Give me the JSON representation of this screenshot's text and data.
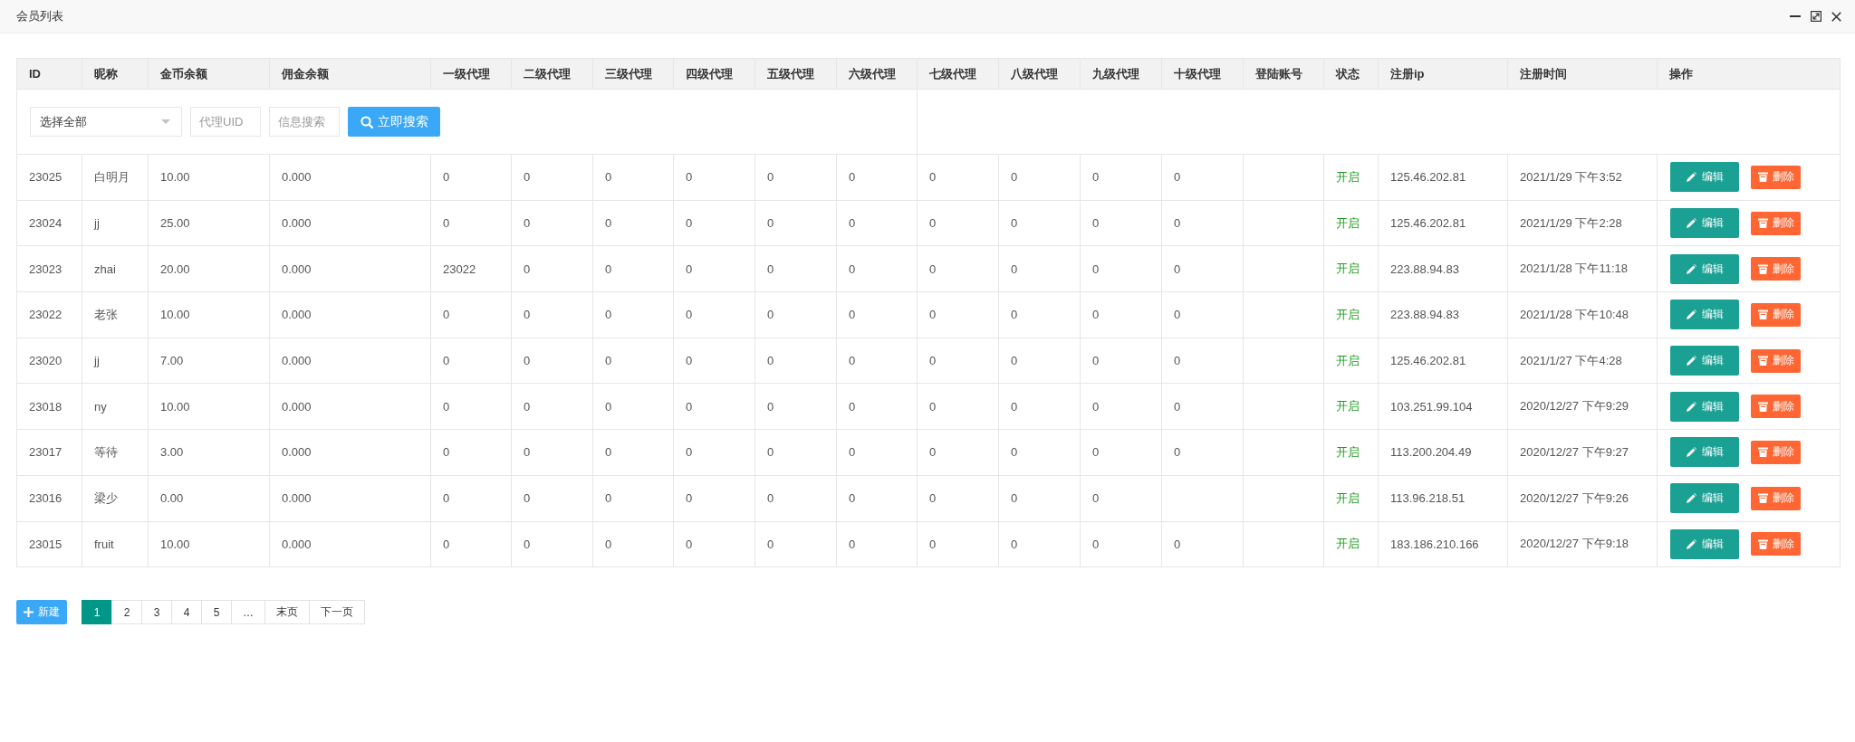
{
  "window": {
    "title": "会员列表"
  },
  "table": {
    "columns": [
      "ID",
      "昵称",
      "金币余额",
      "佣金余额",
      "一级代理",
      "二级代理",
      "三级代理",
      "四级代理",
      "五级代理",
      "六级代理",
      "七级代理",
      "八级代理",
      "九级代理",
      "十级代理",
      "登陆账号",
      "状态",
      "注册ip",
      "注册时间",
      "操作"
    ],
    "filter": {
      "select": {
        "value": "选择全部"
      },
      "agent_uid": {
        "placeholder": "代理UID"
      },
      "info_search": {
        "placeholder": "信息搜索"
      },
      "search_button": "立即搜索"
    },
    "rows": [
      {
        "id": "23025",
        "nickname": "白明月",
        "coins": "10.00",
        "commission": "0.000",
        "agents": [
          "0",
          "0",
          "0",
          "0",
          "0",
          "0",
          "0",
          "0",
          "0",
          "0"
        ],
        "status": "开启",
        "ip": "125.46.202.81",
        "registered": "2021/1/29 下午3:52",
        "actions": [
          {
            "kind": "edit",
            "label": "编辑"
          },
          {
            "kind": "delete",
            "label": "删除"
          }
        ]
      },
      {
        "id": "23024",
        "nickname": "jj",
        "coins": "25.00",
        "commission": "0.000",
        "agents": [
          "0",
          "0",
          "0",
          "0",
          "0",
          "0",
          "0",
          "0",
          "0",
          "0"
        ],
        "status": "开启",
        "ip": "125.46.202.81",
        "registered": "2021/1/29 下午2:28",
        "actions": [
          {
            "kind": "edit",
            "label": "编辑"
          },
          {
            "kind": "delete",
            "label": "删除"
          }
        ]
      },
      {
        "id": "23023",
        "nickname": "zhai",
        "coins": "20.00",
        "commission": "0.000",
        "agents": [
          "23022",
          "0",
          "0",
          "0",
          "0",
          "0",
          "0",
          "0",
          "0",
          "0"
        ],
        "status": "开启",
        "ip": "223.88.94.83",
        "registered": "2021/1/28 下午11:18",
        "actions": [
          {
            "kind": "edit",
            "label": "编辑"
          },
          {
            "kind": "delete",
            "label": "删除"
          }
        ]
      },
      {
        "id": "23022",
        "nickname": "老张",
        "coins": "10.00",
        "commission": "0.000",
        "agents": [
          "0",
          "0",
          "0",
          "0",
          "0",
          "0",
          "0",
          "0",
          "0",
          "0"
        ],
        "status": "开启",
        "ip": "223.88.94.83",
        "registered": "2021/1/28 下午10:48",
        "actions": [
          {
            "kind": "edit",
            "label": "编辑"
          },
          {
            "kind": "delete",
            "label": "删除"
          }
        ]
      },
      {
        "id": "23020",
        "nickname": "jj",
        "coins": "7.00",
        "commission": "0.000",
        "agents": [
          "0",
          "0",
          "0",
          "0",
          "0",
          "0",
          "0",
          "0",
          "0",
          "0"
        ],
        "status": "开启",
        "ip": "125.46.202.81",
        "registered": "2021/1/27 下午4:28",
        "actions": [
          {
            "kind": "edit",
            "label": "编辑"
          },
          {
            "kind": "delete",
            "label": "删除"
          }
        ]
      },
      {
        "id": "23018",
        "nickname": "ny",
        "coins": "10.00",
        "commission": "0.000",
        "agents": [
          "0",
          "0",
          "0",
          "0",
          "0",
          "0",
          "0",
          "0",
          "0",
          "0"
        ],
        "status": "开启",
        "ip": "103.251.99.104",
        "registered": "2020/12/27 下午9:29",
        "actions": [
          {
            "kind": "edit",
            "label": "编辑"
          },
          {
            "kind": "delete",
            "label": "删除"
          }
        ]
      },
      {
        "id": "23017",
        "nickname": "等待",
        "coins": "3.00",
        "commission": "0.000",
        "agents": [
          "0",
          "0",
          "0",
          "0",
          "0",
          "0",
          "0",
          "0",
          "0",
          "0"
        ],
        "status": "开启",
        "ip": "113.200.204.49",
        "registered": "2020/12/27 下午9:27",
        "actions": [
          {
            "kind": "edit",
            "label": "编辑"
          },
          {
            "kind": "delete",
            "label": "删除"
          }
        ]
      },
      {
        "id": "23016",
        "nickname": "梁少",
        "coins": "0.00",
        "commission": "0.000",
        "agents": [
          "0",
          "0",
          "0",
          "0",
          "0",
          "0",
          "0",
          "0",
          "0"
        ],
        "status": "开启",
        "ip": "113.96.218.51",
        "registered": "2020/12/27 下午9:26",
        "actions": [
          {
            "kind": "edit",
            "label": "编辑"
          },
          {
            "kind": "delete",
            "label": "删除"
          }
        ]
      },
      {
        "id": "23015",
        "nickname": "fruit",
        "coins": "10.00",
        "commission": "0.000",
        "agents": [
          "0",
          "0",
          "0",
          "0",
          "0",
          "0",
          "0",
          "0",
          "0",
          "0"
        ],
        "status": "开启",
        "ip": "183.186.210.166",
        "registered": "2020/12/27 下午9:18",
        "actions": [
          {
            "kind": "edit",
            "label": "编辑"
          },
          {
            "kind": "delete",
            "label": "删除"
          }
        ]
      }
    ]
  },
  "footer": {
    "new_button": "新建",
    "pagination": [
      {
        "label": "1",
        "selected": true
      },
      {
        "label": "2",
        "selected": false
      },
      {
        "label": "3",
        "selected": false
      },
      {
        "label": "4",
        "selected": false
      },
      {
        "label": "5",
        "selected": false
      },
      {
        "label": "…",
        "selected": false
      },
      {
        "label": "末页",
        "selected": false
      },
      {
        "label": "下一页",
        "selected": false
      }
    ]
  }
}
